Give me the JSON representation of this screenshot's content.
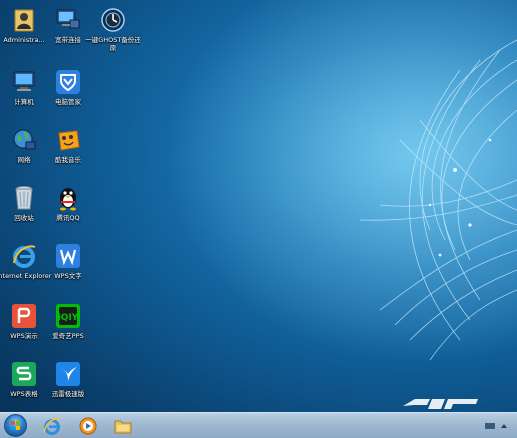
{
  "desktop": {
    "icons": [
      {
        "label": "Administra...",
        "icon": "user-folder-icon"
      },
      {
        "label": "宽带连接",
        "icon": "broadband-connection-icon"
      },
      {
        "label": "一键GHOST备份还原",
        "icon": "onekey-ghost-icon"
      },
      {
        "label": "计算机",
        "icon": "computer-icon"
      },
      {
        "label": "电脑管家",
        "icon": "pc-manager-shield-icon"
      },
      {
        "label": "网络",
        "icon": "network-icon"
      },
      {
        "label": "酷我音乐",
        "icon": "kuwo-music-icon"
      },
      {
        "label": "回收站",
        "icon": "recycle-bin-icon"
      },
      {
        "label": "腾讯QQ",
        "icon": "qq-penguin-icon"
      },
      {
        "label": "Internet Explorer",
        "icon": "internet-explorer-icon"
      },
      {
        "label": "WPS文字",
        "icon": "wps-writer-icon"
      },
      {
        "label": "WPS演示",
        "icon": "wps-presentation-icon"
      },
      {
        "label": "爱奇艺PPS",
        "icon": "iqiyi-pps-icon"
      },
      {
        "label": "WPS表格",
        "icon": "wps-spreadsheet-icon"
      },
      {
        "label": "迅雷极速版",
        "icon": "xunlei-icon"
      }
    ]
  },
  "taskbar": {
    "pinned": [
      {
        "name": "internet-explorer-icon"
      },
      {
        "name": "media-player-icon"
      },
      {
        "name": "file-explorer-icon"
      }
    ]
  },
  "colors": {
    "wpsRed": "#e8523a",
    "wpsBlue": "#2d7fe0",
    "wpsGreen": "#1aa85a",
    "iqiyiGreen": "#00be06"
  }
}
